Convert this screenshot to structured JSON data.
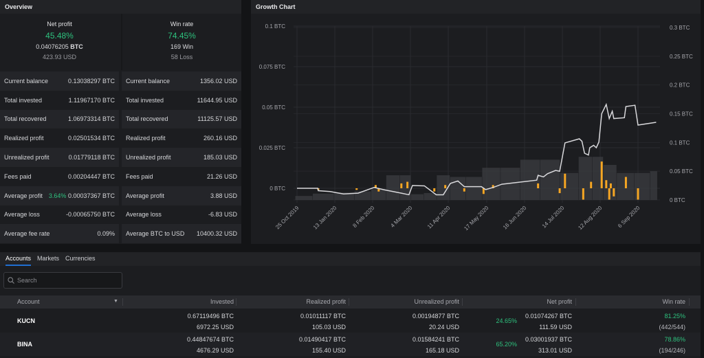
{
  "overview": {
    "title": "Overview",
    "net_profit": {
      "label": "Net profit",
      "pct": "45.48%",
      "btc": "0.04076205",
      "btc_unit": "BTC",
      "usd": "423.93 USD"
    },
    "win_rate": {
      "label": "Win rate",
      "pct": "74.45%",
      "wins": "169 Win",
      "losses": "58 Loss"
    },
    "btc_rows": [
      {
        "label": "Current balance",
        "value": "0.13038297 BTC"
      },
      {
        "label": "Total invested",
        "value": "1.11967170 BTC"
      },
      {
        "label": "Total recovered",
        "value": "1.06973314 BTC"
      },
      {
        "label": "Realized profit",
        "value": "0.02501534 BTC"
      },
      {
        "label": "Unrealized profit",
        "value": "0.01779118 BTC"
      },
      {
        "label": "Fees paid",
        "value": "0.00204447 BTC"
      },
      {
        "label": "Average profit",
        "extra": "3.64%",
        "value": "0.00037367 BTC"
      },
      {
        "label": "Average loss",
        "value": "-0.00065750 BTC"
      },
      {
        "label": "Average fee rate",
        "value": "0.09%"
      }
    ],
    "usd_rows": [
      {
        "label": "Current balance",
        "value": "1356.02 USD"
      },
      {
        "label": "Total invested",
        "value": "11644.95 USD"
      },
      {
        "label": "Total recovered",
        "value": "11125.57 USD"
      },
      {
        "label": "Realized profit",
        "value": "260.16 USD"
      },
      {
        "label": "Unrealized profit",
        "value": "185.03 USD"
      },
      {
        "label": "Fees paid",
        "value": "21.26 USD"
      },
      {
        "label": "Average profit",
        "value": "3.88 USD"
      },
      {
        "label": "Average loss",
        "value": "-6.83 USD"
      },
      {
        "label": "Average BTC to USD",
        "value": "10400.32 USD"
      }
    ]
  },
  "chart_title": "Growth Chart",
  "chart_data": {
    "type": "line+bar",
    "colors": {
      "line": "#d9d9dc",
      "profit_bars": "#f6a623",
      "volume_bars": "#3a3b3e"
    },
    "x_ticks": [
      "2019-10-25",
      "2020-01-13",
      "2020-02-08",
      "2020-03-04",
      "2020-04-11",
      "2020-05-17",
      "2020-06-16",
      "2020-07-14",
      "2020-08-12",
      "2020-09-06"
    ],
    "x_tick_labels": [
      "25 Oct 2019",
      "13 Jan 2020",
      "8 Feb 2020",
      "4 Mar 2020",
      "11 Apr 2020",
      "17 May 2020",
      "16 Jun 2020",
      "14 Jul 2020",
      "12 Aug 2020",
      "6 Sep 2020"
    ],
    "y_left": {
      "range": [
        0,
        0.1
      ],
      "ticks": [
        0,
        0.025,
        0.05,
        0.075,
        0.1
      ],
      "tick_labels": [
        "0 BTC",
        "0.025 BTC",
        "0.05 BTC",
        "0.075 BTC",
        "0.1 BTC"
      ]
    },
    "y_right": {
      "range": [
        0,
        0.3
      ],
      "ticks": [
        0,
        0.05,
        0.1,
        0.15,
        0.2,
        0.25,
        0.3
      ],
      "tick_labels": [
        "0 BTC",
        "0.05 BTC",
        "0.1 BTC",
        "0.15 BTC",
        "0.2 BTC",
        "0.25 BTC",
        "0.3 BTC"
      ]
    },
    "grid": true,
    "line_series": {
      "axis": "left",
      "points": [
        [
          "2019-10-25",
          0
        ],
        [
          "2019-12-08",
          0
        ],
        [
          "2019-12-09",
          -0.0015
        ],
        [
          "2020-01-03",
          -0.002
        ],
        [
          "2020-01-19",
          -0.0035
        ],
        [
          "2020-01-29",
          -0.003
        ],
        [
          "2020-02-09",
          0.0005
        ],
        [
          "2020-02-16",
          -0.001
        ],
        [
          "2020-02-27",
          -0.003
        ],
        [
          "2020-03-03",
          -0.004
        ],
        [
          "2020-03-06",
          0.0017
        ],
        [
          "2020-03-18",
          0.0015
        ],
        [
          "2020-03-30",
          -0.004
        ],
        [
          "2020-04-06",
          -0.004
        ],
        [
          "2020-04-13",
          0.003
        ],
        [
          "2020-04-20",
          0.0045
        ],
        [
          "2020-04-26",
          0.001
        ],
        [
          "2020-05-12",
          0.001
        ],
        [
          "2020-05-16",
          -0.0008
        ],
        [
          "2020-05-22",
          0.0005
        ],
        [
          "2020-05-29",
          0.0025
        ],
        [
          "2020-06-25",
          0.005
        ],
        [
          "2020-06-26",
          0.008
        ],
        [
          "2020-06-30",
          0.007
        ],
        [
          "2020-07-03",
          0.009
        ],
        [
          "2020-07-09",
          0.011
        ],
        [
          "2020-07-12",
          0.0105
        ],
        [
          "2020-07-16",
          0.028
        ],
        [
          "2020-07-27",
          0.0305
        ],
        [
          "2020-07-29",
          0.029
        ],
        [
          "2020-07-31",
          0.0216
        ],
        [
          "2020-08-03",
          0.0205
        ],
        [
          "2020-08-04",
          0.025
        ],
        [
          "2020-08-07",
          0.0265
        ],
        [
          "2020-08-09",
          0.025
        ],
        [
          "2020-08-11",
          0.0285
        ],
        [
          "2020-08-13",
          0.046
        ],
        [
          "2020-08-16",
          0.0517
        ],
        [
          "2020-08-18",
          0.043
        ],
        [
          "2020-08-20",
          0.0475
        ],
        [
          "2020-08-21",
          0.043
        ],
        [
          "2020-08-28",
          0.0435
        ],
        [
          "2020-08-29",
          0.0504
        ],
        [
          "2020-09-04",
          0.0512
        ],
        [
          "2020-09-06",
          0.039
        ],
        [
          "2020-09-18",
          0.0407
        ]
      ]
    },
    "profit_bars": {
      "axis": "left",
      "points": [
        [
          "2019-12-09",
          -0.001
        ],
        [
          "2020-01-28",
          -0.001
        ],
        [
          "2020-02-10",
          0.002
        ],
        [
          "2020-02-12",
          -0.002
        ],
        [
          "2020-02-27",
          0.003
        ],
        [
          "2020-03-02",
          0.004
        ],
        [
          "2020-03-28",
          -0.002
        ],
        [
          "2020-04-08",
          0.002
        ],
        [
          "2020-04-26",
          -0.002
        ],
        [
          "2020-05-14",
          -0.0035
        ],
        [
          "2020-05-22",
          0.002
        ],
        [
          "2020-06-26",
          0.003
        ],
        [
          "2020-07-12",
          -0.003
        ],
        [
          "2020-07-16",
          0.009
        ],
        [
          "2020-07-30",
          -0.007
        ],
        [
          "2020-08-05",
          0.004
        ],
        [
          "2020-08-13",
          0.0165
        ],
        [
          "2020-08-16",
          0.005
        ],
        [
          "2020-08-18",
          -0.007
        ],
        [
          "2020-08-19",
          0.003
        ],
        [
          "2020-08-21",
          -0.005
        ],
        [
          "2020-08-29",
          0.007
        ],
        [
          "2020-09-06",
          -0.007
        ]
      ]
    },
    "volume_bars": {
      "axis": "right",
      "points": [
        [
          "2019-11-05",
          0.007
        ],
        [
          "2019-12-20",
          0.011
        ],
        [
          "2020-01-20",
          0.013
        ],
        [
          "2020-02-02",
          0.015
        ],
        [
          "2020-02-12",
          0.019
        ],
        [
          "2020-02-22",
          0.043
        ],
        [
          "2020-03-01",
          0.043
        ],
        [
          "2020-03-10",
          0.01
        ],
        [
          "2020-03-25",
          0.012
        ],
        [
          "2020-04-05",
          0.043
        ],
        [
          "2020-04-20",
          0.04
        ],
        [
          "2020-05-05",
          0.04
        ],
        [
          "2020-05-20",
          0.056
        ],
        [
          "2020-06-05",
          0.056
        ],
        [
          "2020-06-20",
          0.07
        ],
        [
          "2020-07-05",
          0.07
        ],
        [
          "2020-07-20",
          0.047
        ],
        [
          "2020-08-02",
          0.075
        ],
        [
          "2020-08-10",
          0.075
        ],
        [
          "2020-08-18",
          0.061
        ],
        [
          "2020-08-28",
          0.047
        ],
        [
          "2020-09-10",
          0.047
        ],
        [
          "2020-09-18",
          0.05
        ]
      ]
    }
  },
  "bottom": {
    "tabs": [
      "Accounts",
      "Markets",
      "Currencies"
    ],
    "search_placeholder": "Search",
    "columns": [
      "Account",
      "Invested",
      "Realized profit",
      "Unrealized profit",
      "Net profit",
      "Win rate"
    ],
    "rows": [
      {
        "account": "KUCN",
        "invested_btc": "0.67119496 BTC",
        "invested_usd": "6972.25 USD",
        "realized_btc": "0.01011117 BTC",
        "realized_usd": "105.03 USD",
        "unrealized_btc": "0.00194877 BTC",
        "unrealized_usd": "20.24 USD",
        "net_pct": "24.65%",
        "net_btc": "0.01074267 BTC",
        "net_usd": "111.59 USD",
        "win_pct": "81.25%",
        "win_count": "(442/544)"
      },
      {
        "account": "BINA",
        "invested_btc": "0.44847674 BTC",
        "invested_usd": "4676.29 USD",
        "realized_btc": "0.01490417 BTC",
        "realized_usd": "155.40 USD",
        "unrealized_btc": "0.01584241 BTC",
        "unrealized_usd": "165.18 USD",
        "net_pct": "65.20%",
        "net_btc": "0.03001937 BTC",
        "net_usd": "313.01 USD",
        "win_pct": "78.86%",
        "win_count": "(194/246)"
      }
    ]
  }
}
